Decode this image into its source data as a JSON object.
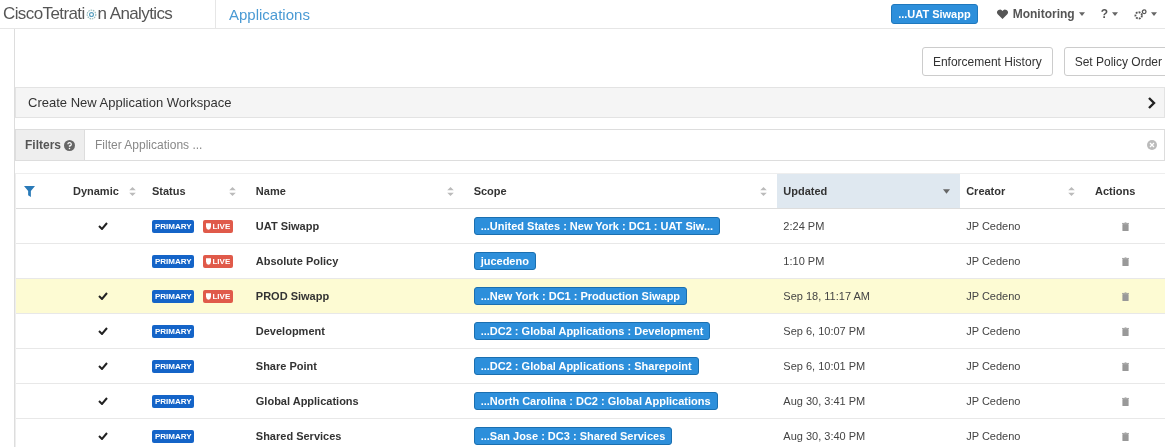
{
  "header": {
    "logo_parts": [
      "CiscoTetrati",
      "n Analytics"
    ],
    "page_title": "Applications",
    "scope_button": "...UAT Siwapp",
    "menus": [
      {
        "kind": "heart",
        "label": "Monitoring"
      },
      {
        "kind": "none",
        "label": "?"
      },
      {
        "kind": "gear"
      }
    ]
  },
  "actions": [
    "Enforcement History",
    "Set Policy Order"
  ],
  "workspace_bar": {
    "label": "Create New Application Workspace"
  },
  "filter": {
    "label": "Filters",
    "placeholder": "Filter Applications ..."
  },
  "table": {
    "columns": [
      {
        "label": "Dynamic",
        "sortable": true,
        "selected": false
      },
      {
        "label": "Status",
        "sortable": true,
        "selected": false
      },
      {
        "label": "Name",
        "sortable": true,
        "selected": false
      },
      {
        "label": "Scope",
        "sortable": true,
        "selected": false
      },
      {
        "label": "Updated",
        "sortable": true,
        "selected": true
      },
      {
        "label": "Creator",
        "sortable": true,
        "selected": false
      },
      {
        "label": "Actions",
        "sortable": false,
        "selected": false
      }
    ],
    "rows": [
      {
        "dynamic": true,
        "badges": [
          {
            "kind": "primary",
            "label": "PRIMARY"
          },
          {
            "kind": "live",
            "label": "LIVE"
          }
        ],
        "name": "UAT Siwapp",
        "scope": "...United States : New York : DC1 : UAT Siw...",
        "updated": "2:24 PM",
        "creator": "JP Cedeno",
        "highlighted": false
      },
      {
        "dynamic": false,
        "badges": [
          {
            "kind": "primary",
            "label": "PRIMARY"
          },
          {
            "kind": "live",
            "label": "LIVE"
          }
        ],
        "name": "Absolute Policy",
        "scope": "jucedeno",
        "updated": "1:10 PM",
        "creator": "JP Cedeno",
        "highlighted": false
      },
      {
        "dynamic": true,
        "badges": [
          {
            "kind": "primary",
            "label": "PRIMARY"
          },
          {
            "kind": "live",
            "label": "LIVE"
          }
        ],
        "name": "PROD Siwapp",
        "scope": "...New York : DC1 : Production Siwapp",
        "updated": "Sep 18, 11:17 AM",
        "creator": "JP Cedeno",
        "highlighted": true
      },
      {
        "dynamic": true,
        "badges": [
          {
            "kind": "primary",
            "label": "PRIMARY"
          }
        ],
        "name": "Development",
        "scope": "...DC2 : Global Applications : Development",
        "updated": "Sep 6, 10:07 PM",
        "creator": "JP Cedeno",
        "highlighted": false
      },
      {
        "dynamic": true,
        "badges": [
          {
            "kind": "primary",
            "label": "PRIMARY"
          }
        ],
        "name": "Share Point",
        "scope": "...DC2 : Global Applications : Sharepoint",
        "updated": "Sep 6, 10:01 PM",
        "creator": "JP Cedeno",
        "highlighted": false
      },
      {
        "dynamic": true,
        "badges": [
          {
            "kind": "primary",
            "label": "PRIMARY"
          }
        ],
        "name": "Global Applications",
        "scope": "...North Carolina : DC2 : Global Applications",
        "updated": "Aug 30, 3:41 PM",
        "creator": "JP Cedeno",
        "highlighted": false
      },
      {
        "dynamic": true,
        "badges": [
          {
            "kind": "primary",
            "label": "PRIMARY"
          }
        ],
        "name": "Shared Services",
        "scope": "...San Jose : DC3 : Shared Services",
        "updated": "Aug 30, 3:40 PM",
        "creator": "JP Cedeno",
        "highlighted": false
      }
    ]
  }
}
